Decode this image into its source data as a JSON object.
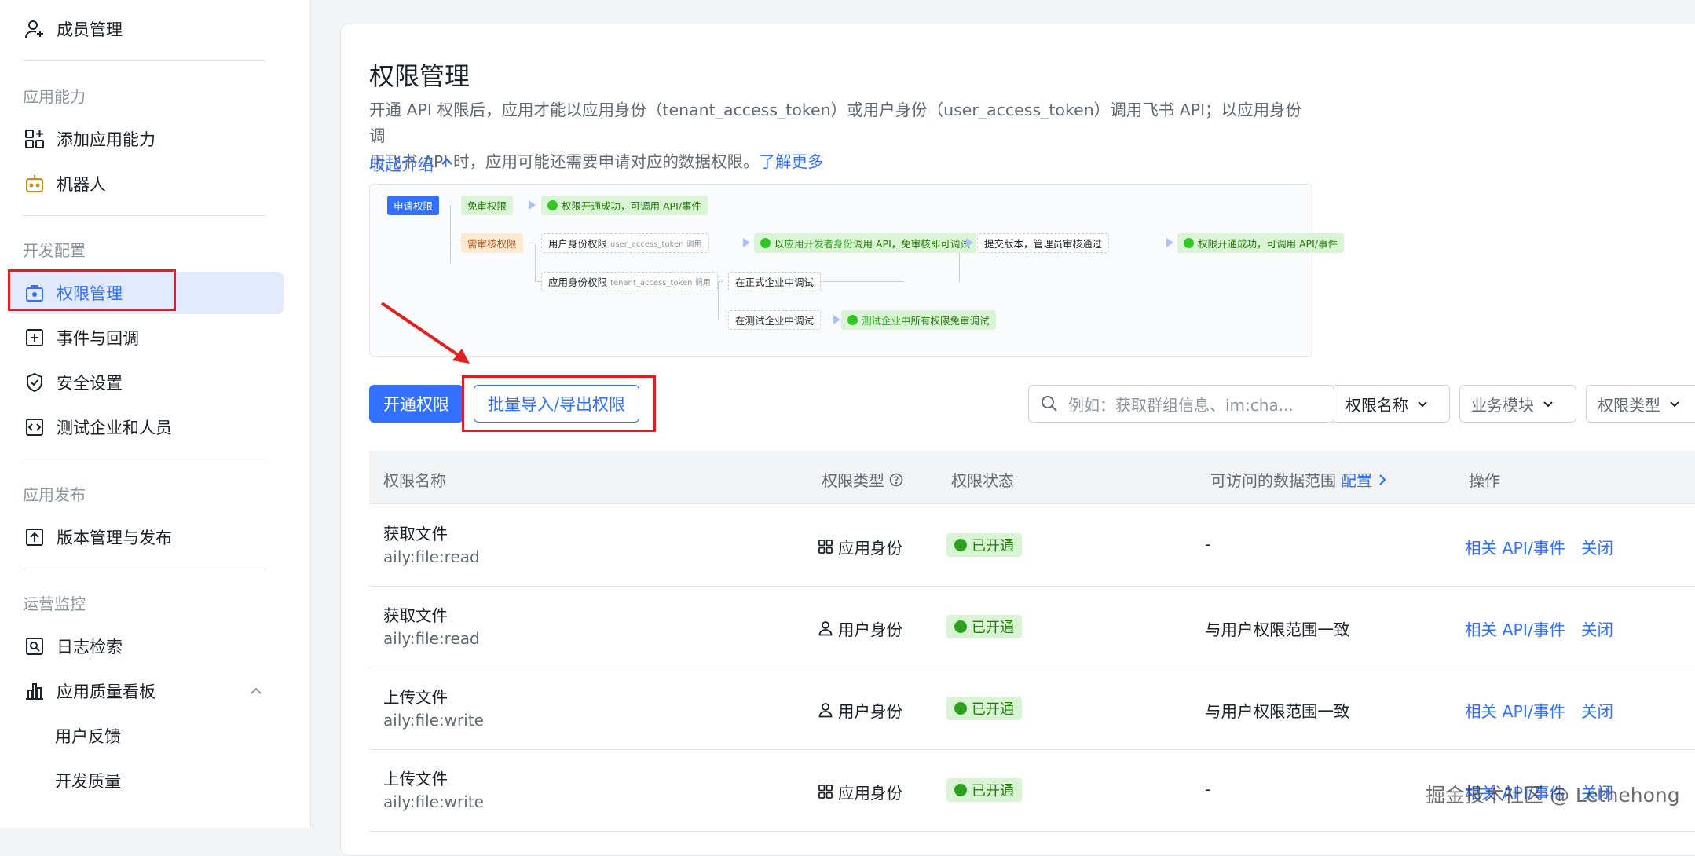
{
  "sidebar": {
    "member_mgmt": "成员管理",
    "groups": {
      "app_ability": "应用能力",
      "dev_config": "开发配置",
      "app_release": "应用发布",
      "ops_monitor": "运营监控"
    },
    "items": {
      "add_ability": "添加应用能力",
      "bot": "机器人",
      "permission": "权限管理",
      "events": "事件与回调",
      "security": "安全设置",
      "test_company": "测试企业和人员",
      "version": "版本管理与发布",
      "log_search": "日志检索",
      "quality_board": "应用质量看板",
      "user_feedback": "用户反馈",
      "dev_quality": "开发质量"
    }
  },
  "main": {
    "title": "权限管理",
    "desc_line1": "开通 API 权限后，应用才能以应用身份（tenant_access_token）或用户身份（user_access_token）调用飞书 API；以应用身份调",
    "desc_line2": "用飞书 API 时，应用可能还需要申请对应的数据权限。",
    "learn_more": "了解更多",
    "collapse": "收起介绍"
  },
  "flow": {
    "apply": "申请权限",
    "no_review": "免审权限",
    "success_direct": "权限开通成功，可调用 API/事件",
    "need_review": "需审核权限",
    "user_perm": "用户身份权限",
    "user_token": "user_access_token 调用",
    "dev_identity_call_pre": "以",
    "dev_identity": "应用开发者身份",
    "dev_identity_call_post": "调用 API，免审核即可调试",
    "submit": "提交版本，管理员审核通过",
    "success_final": "权限开通成功，可调用 API/事件",
    "app_perm": "应用身份权限",
    "tenant_token": "tenant_access_token 调用",
    "in_prod": "在正式企业中调试",
    "in_test": "在测试企业中调试",
    "test_all_pre": "测试企业",
    "test_all_post": "中所有权限免审调试"
  },
  "toolbar": {
    "enable_btn": "开通权限",
    "batch_btn": "批量导入/导出权限",
    "search_placeholder": "例如：获取群组信息、im:cha...",
    "filter_name": "权限名称",
    "filter_module": "业务模块",
    "filter_type": "权限类型"
  },
  "table": {
    "headers": {
      "name": "权限名称",
      "type": "权限类型",
      "status": "权限状态",
      "scope": "可访问的数据范围",
      "config": "配置",
      "ops": "操作"
    },
    "rows": [
      {
        "name": "获取文件",
        "code": "aily:file:read",
        "type": "应用身份",
        "status": "已开通",
        "scope": "-",
        "op1": "相关 API/事件",
        "op2": "关闭"
      },
      {
        "name": "获取文件",
        "code": "aily:file:read",
        "type": "用户身份",
        "status": "已开通",
        "scope": "与用户权限范围一致",
        "op1": "相关 API/事件",
        "op2": "关闭"
      },
      {
        "name": "上传文件",
        "code": "aily:file:write",
        "type": "用户身份",
        "status": "已开通",
        "scope": "与用户权限范围一致",
        "op1": "相关 API/事件",
        "op2": "关闭"
      },
      {
        "name": "上传文件",
        "code": "aily:file:write",
        "type": "应用身份",
        "status": "已开通",
        "scope": "-",
        "op1": "相关 API/事件",
        "op2": "关闭"
      }
    ]
  },
  "watermark": "掘金技术社区 @ Lethehong",
  "colors": {
    "accent": "#3370ff",
    "highlight": "#e02020",
    "success": "#2ea121"
  }
}
